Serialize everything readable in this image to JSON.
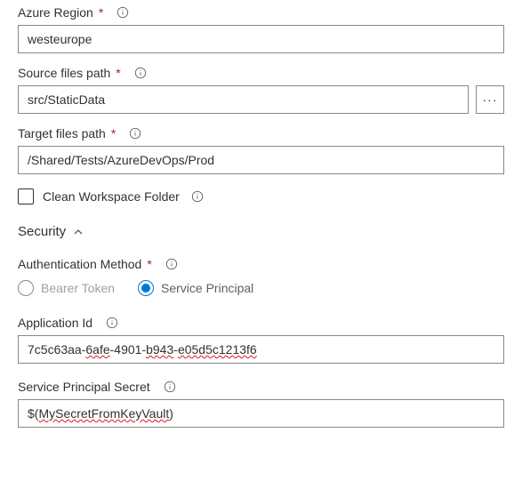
{
  "azure_region": {
    "label": "Azure Region",
    "value": "westeurope"
  },
  "source_files_path": {
    "label": "Source files path",
    "value": "src/StaticData",
    "browse": "···"
  },
  "target_files_path": {
    "label": "Target files path",
    "value": "/Shared/Tests/AzureDevOps/Prod"
  },
  "clean_workspace": {
    "label": "Clean Workspace Folder"
  },
  "security": {
    "title": "Security"
  },
  "auth_method": {
    "label": "Authentication Method",
    "options": {
      "bearer": "Bearer Token",
      "sp": "Service Principal"
    }
  },
  "application_id": {
    "label": "Application Id",
    "p1": "7c5c63aa-",
    "p2": "6afe",
    "p3": "-4901-",
    "p4": "b943",
    "p5": "-",
    "p6": "e05d5c1213f6"
  },
  "sp_secret": {
    "label": "Service Principal Secret",
    "p1": "$(",
    "p2": "MySecretFromKeyVault",
    "p3": ")"
  }
}
